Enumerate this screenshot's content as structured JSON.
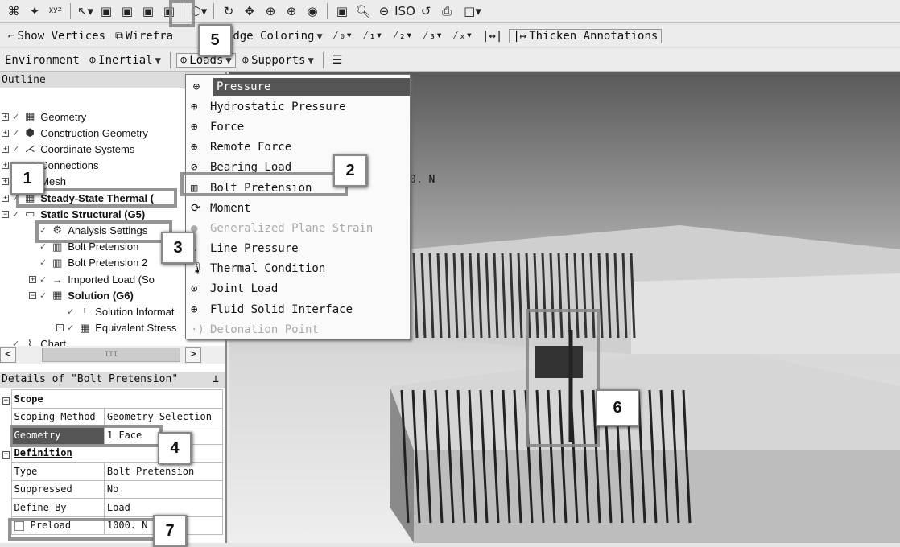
{
  "toolbar1": {
    "icons": [
      "label-icon",
      "probe-icon",
      "coordinate-icon",
      "select-mode-icon",
      "select-vertex-icon",
      "select-edge-icon",
      "select-face-icon",
      "select-body-icon",
      "view-cube-icon",
      "rotate-icon",
      "pan-icon",
      "zoom-icon",
      "box-zoom-icon",
      "zoom-fit-icon",
      "zoom-region-icon",
      "magnify-icon",
      "zoom-out-icon",
      "iso-icon",
      "previous-view-icon",
      "print-icon",
      "viewport-icon"
    ]
  },
  "toolbar2": {
    "show_vertices": "Show Vertices",
    "wireframe": "Wirefra",
    "edge_coloring": "Edge Coloring",
    "thicken": "Thicken Annotations"
  },
  "toolbar3": {
    "environment": "Environment",
    "inertial": "Inertial",
    "loads": "Loads",
    "supports": "Supports"
  },
  "outline": {
    "title": "Outline",
    "items": [
      {
        "label": "Geometry",
        "bold": false
      },
      {
        "label": "Construction Geometry",
        "bold": false
      },
      {
        "label": "Coordinate Systems",
        "bold": false
      },
      {
        "label": "Connections",
        "bold": false
      },
      {
        "label": "Mesh",
        "bold": false
      },
      {
        "label": "Steady-State Thermal (",
        "bold": true
      },
      {
        "label": "Static Structural (G5)",
        "bold": true
      },
      {
        "label": "Analysis Settings",
        "bold": false
      },
      {
        "label": "Bolt Pretension",
        "bold": false
      },
      {
        "label": "Bolt Pretension 2",
        "bold": false
      },
      {
        "label": "Imported Load (So",
        "bold": false
      },
      {
        "label": "Solution (G6)",
        "bold": true
      },
      {
        "label": "Solution Informat",
        "bold": false
      },
      {
        "label": "Equivalent Stress",
        "bold": false
      },
      {
        "label": "Chart",
        "bold": false
      }
    ]
  },
  "details": {
    "title": "Details of \"Bolt Pretension\"",
    "scope": "Scope",
    "definition": "Definition",
    "rows": [
      [
        "Scoping Method",
        "Geometry Selection"
      ],
      [
        "Geometry",
        "1 Face"
      ],
      [
        "Type",
        "Bolt Pretension"
      ],
      [
        "Suppressed",
        "No"
      ],
      [
        "Define By",
        "Load"
      ],
      [
        "Preload",
        "1000. N"
      ]
    ]
  },
  "loads_menu": [
    {
      "label": "Pressure",
      "state": "selected"
    },
    {
      "label": "Hydrostatic Pressure"
    },
    {
      "label": "Force"
    },
    {
      "label": "Remote Force"
    },
    {
      "label": "Bearing Load"
    },
    {
      "label": "Bolt Pretension"
    },
    {
      "label": "Moment"
    },
    {
      "label": "Generalized Plane Strain",
      "state": "disabled"
    },
    {
      "label": "Line Pressure"
    },
    {
      "label": "Thermal Condition"
    },
    {
      "label": "Joint Load"
    },
    {
      "label": "Fluid Solid Interface"
    },
    {
      "label": "Detonation Point",
      "state": "disabled"
    }
  ],
  "viewport": {
    "annotation": "0. N"
  },
  "callouts": [
    "1",
    "2",
    "3",
    "4",
    "5",
    "6",
    "7"
  ]
}
